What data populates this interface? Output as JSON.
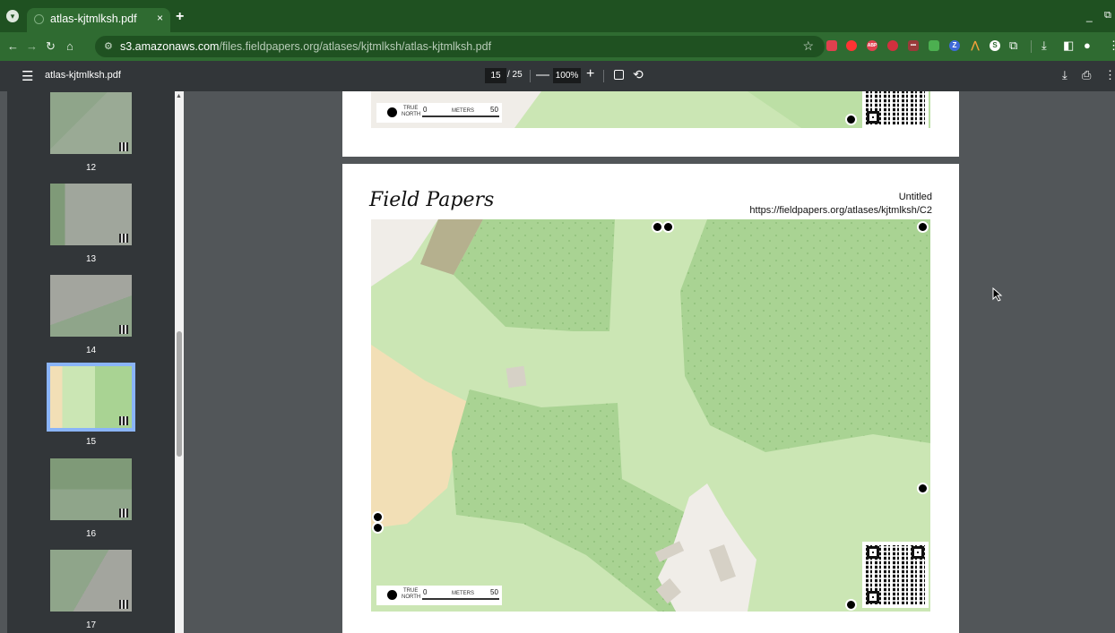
{
  "browser": {
    "tab_title": "atlas-kjtmlksh.pdf",
    "tab_close": "×",
    "new_tab": "+",
    "url_host": "s3.amazonaws.com",
    "url_path": "/files.fieldpapers.org/atlases/kjtmlksh/atlas-kjtmlksh.pdf",
    "window_min": "_",
    "window_max": "⧉",
    "extensions": [
      {
        "name": "pocket-icon",
        "label": "",
        "color": "#e0404e"
      },
      {
        "name": "opera-icon",
        "label": "",
        "color": "#ff3333"
      },
      {
        "name": "adblock-icon",
        "label": "ABP",
        "color": "#e0404e"
      },
      {
        "name": "ublock-icon",
        "label": "",
        "color": "#d0303e"
      },
      {
        "name": "password-icon",
        "label": "•••",
        "color": "#9a3a3a"
      },
      {
        "name": "shield-ext-icon",
        "label": "",
        "color": "#4caf50"
      },
      {
        "name": "z-ext-icon",
        "label": "Z",
        "color": "#3f6ad8"
      },
      {
        "name": "rainbow-ext-icon",
        "label": "",
        "color": "#f2a13a"
      },
      {
        "name": "s-ext-icon",
        "label": "S",
        "color": "#ffffff"
      },
      {
        "name": "puzzle-icon",
        "label": "",
        "color": "#ffffff"
      }
    ]
  },
  "pdf": {
    "doc_title": "atlas-kjtmlksh.pdf",
    "current_page": "15",
    "total_pages": "/ 25",
    "zoom": "100%",
    "zoom_minus": "—",
    "zoom_plus": "+"
  },
  "thumbnails": [
    {
      "num": "12",
      "selected": false
    },
    {
      "num": "13",
      "selected": false
    },
    {
      "num": "14",
      "selected": false
    },
    {
      "num": "15",
      "selected": true
    },
    {
      "num": "16",
      "selected": false
    },
    {
      "num": "17",
      "selected": false
    }
  ],
  "page": {
    "logo": "Field Papers",
    "title": "Untitled",
    "url": "https://fieldpapers.org/atlases/kjtmlksh/C2",
    "scale_true": "TRUE",
    "scale_north": "NORTH",
    "scale_zero": "0",
    "scale_meters": "METERS",
    "scale_fifty": "50"
  }
}
